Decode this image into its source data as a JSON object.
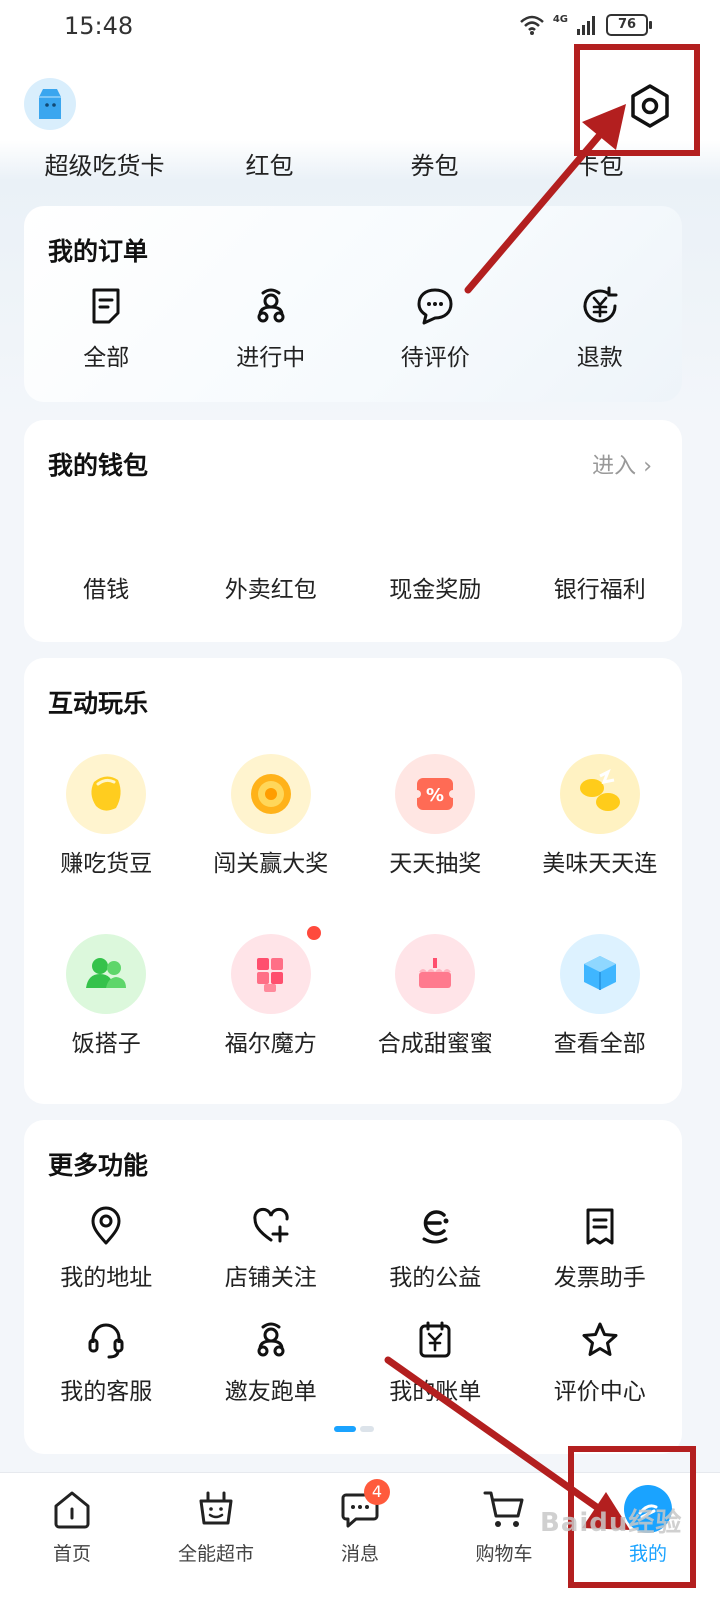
{
  "status_bar": {
    "time": "15:48",
    "network": "4G",
    "battery": "76"
  },
  "header": {
    "quick_links": [
      "超级吃货卡",
      "红包",
      "券包",
      "卡包"
    ]
  },
  "orders": {
    "title": "我的订单",
    "items": [
      {
        "label": "全部",
        "icon": "order-doc-icon"
      },
      {
        "label": "进行中",
        "icon": "scooter-icon"
      },
      {
        "label": "待评价",
        "icon": "comment-icon"
      },
      {
        "label": "退款",
        "icon": "refund-icon"
      }
    ]
  },
  "wallet": {
    "title": "我的钱包",
    "enter_label": "进入",
    "items": [
      "借钱",
      "外卖红包",
      "现金奖励",
      "银行福利"
    ]
  },
  "games": {
    "title": "互动玩乐",
    "row1": [
      {
        "label": "赚吃货豆",
        "icon": "bean-icon"
      },
      {
        "label": "闯关赢大奖",
        "icon": "orange-slice-icon"
      },
      {
        "label": "天天抽奖",
        "icon": "coupon-ticket-icon"
      },
      {
        "label": "美味天天连",
        "icon": "lemon-icon"
      }
    ],
    "row2": [
      {
        "label": "饭搭子",
        "icon": "friends-icon"
      },
      {
        "label": "福尔魔方",
        "icon": "rubik-cube-icon"
      },
      {
        "label": "合成甜蜜蜜",
        "icon": "cake-icon"
      },
      {
        "label": "查看全部",
        "icon": "cube-icon"
      }
    ]
  },
  "more": {
    "title": "更多功能",
    "row1": [
      {
        "label": "我的地址",
        "icon": "location-pin-icon"
      },
      {
        "label": "店铺关注",
        "icon": "heart-plus-icon"
      },
      {
        "label": "我的公益",
        "icon": "charity-icon"
      },
      {
        "label": "发票助手",
        "icon": "invoice-icon"
      }
    ],
    "row2": [
      {
        "label": "我的客服",
        "icon": "headset-icon"
      },
      {
        "label": "邀友跑单",
        "icon": "scooter-icon"
      },
      {
        "label": "我的账单",
        "icon": "bill-icon"
      },
      {
        "label": "评价中心",
        "icon": "star-icon"
      }
    ]
  },
  "tab_bar": {
    "tabs": [
      {
        "label": "首页",
        "icon": "home-icon"
      },
      {
        "label": "全能超市",
        "icon": "supermarket-icon"
      },
      {
        "label": "消息",
        "icon": "message-icon",
        "badge": "4"
      },
      {
        "label": "购物车",
        "icon": "cart-icon"
      },
      {
        "label": "我的",
        "icon": "profile-icon",
        "active": true
      }
    ]
  },
  "watermark": "Baidu经验",
  "colors": {
    "accent": "#1aa3ff",
    "annotation": "#b31f1f",
    "badge": "#ff5a3c"
  }
}
